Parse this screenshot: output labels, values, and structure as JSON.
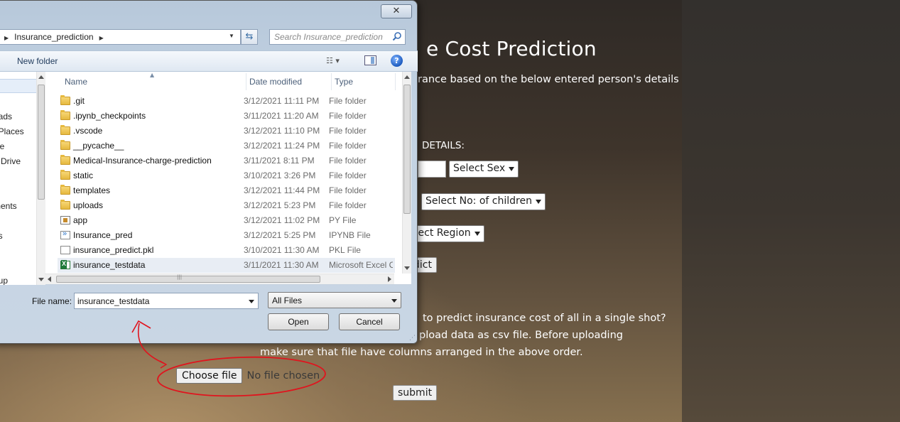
{
  "web": {
    "title": "e Cost Prediction",
    "subtitle": "rance based on the below entered person's details",
    "details_label": "DETAILS:",
    "select_sex": "Select Sex",
    "select_children": "Select No: of children",
    "select_region": "elect Region",
    "predict_btn": "dict",
    "bulk_line1": "to predict insurance cost of all in a single shot?",
    "bulk_line2": "pload data as csv file. Before uploading",
    "bulk_line3": "make sure that file have columns arranged in the above order.",
    "choose_file_btn": "Choose file",
    "no_file_text": "No file chosen",
    "submit_btn": "submit"
  },
  "dialog": {
    "close_label": "✕",
    "address": "Insurance_prediction",
    "search_placeholder": "Search Insurance_prediction",
    "new_folder_label": "New folder",
    "help_label": "?",
    "columns": {
      "name": "Name",
      "date": "Date modified",
      "type": "Type"
    },
    "nav_items": [
      "s",
      "p",
      "oads",
      "t Places",
      "ive",
      "e Drive",
      "",
      "ments",
      "",
      "es",
      "",
      "oup"
    ],
    "files": [
      {
        "name": ".git",
        "date": "3/12/2021 11:11 PM",
        "type": "File folder",
        "icon": "folder-icon"
      },
      {
        "name": ".ipynb_checkpoints",
        "date": "3/11/2021 11:20 AM",
        "type": "File folder",
        "icon": "folder-icon"
      },
      {
        "name": ".vscode",
        "date": "3/12/2021 11:10 PM",
        "type": "File folder",
        "icon": "folder-icon"
      },
      {
        "name": "__pycache__",
        "date": "3/12/2021 11:24 PM",
        "type": "File folder",
        "icon": "folder-icon"
      },
      {
        "name": "Medical-Insurance-charge-prediction",
        "date": "3/11/2021 8:11 PM",
        "type": "File folder",
        "icon": "folder-icon"
      },
      {
        "name": "static",
        "date": "3/10/2021 3:26 PM",
        "type": "File folder",
        "icon": "folder-icon"
      },
      {
        "name": "templates",
        "date": "3/12/2021 11:44 PM",
        "type": "File folder",
        "icon": "folder-icon"
      },
      {
        "name": "uploads",
        "date": "3/12/2021 5:23 PM",
        "type": "File folder",
        "icon": "folder-icon"
      },
      {
        "name": "app",
        "date": "3/12/2021 11:02 PM",
        "type": "PY File",
        "icon": "python-file-icon"
      },
      {
        "name": "Insurance_pred",
        "date": "3/12/2021 5:25 PM",
        "type": "IPYNB File",
        "icon": "notebook-file-icon"
      },
      {
        "name": "insurance_predict.pkl",
        "date": "3/10/2021 11:30 AM",
        "type": "PKL File",
        "icon": "generic-file-icon"
      },
      {
        "name": "insurance_testdata",
        "date": "3/11/2021 11:30 AM",
        "type": "Microsoft Excel C",
        "icon": "excel-file-icon"
      }
    ],
    "file_name_label": "File name:",
    "file_name_value": "insurance_testdata",
    "file_type_value": "All Files",
    "open_btn": "Open",
    "cancel_btn": "Cancel"
  },
  "colors": {
    "annotation": "#e0141e",
    "dialog_chrome": "#c2d2e3",
    "page_text": "#ffffff"
  }
}
